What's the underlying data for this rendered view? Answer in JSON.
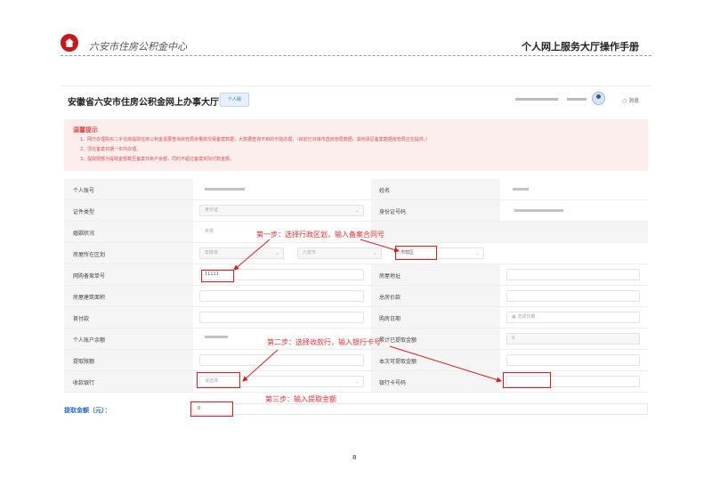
{
  "doc": {
    "org_name": "六安市住房公积金中心",
    "manual_title": "个人网上服务大厅操作手册",
    "page_number": "8"
  },
  "site": {
    "title": "安徽省六安市住房公积金网上办事大厅",
    "badge": "个人版",
    "message_link": "消息"
  },
  "tips": {
    "title": "温馨提示",
    "items": [
      "1、网厅办理购买二手住房提取住房公积金需要查询房管局存量房交易备案数据，大数据查询不到的不能办理；（目前已对接市直房管局数据，其他县区备案数据房管局正在提供。）",
      "2、须在备案日期一年内办理。",
      "3、提取限额为提取金额截至备案日账户余额，同时不超过备案实际付款金额。"
    ]
  },
  "form": {
    "account_label": "个人账号",
    "name_label": "姓名",
    "id_type_label": "证件类型",
    "id_type_value": "身份证",
    "id_number_label": "身份证号码",
    "marital_label": "婚姻状况",
    "marital_value": "未婚",
    "district_label": "房屋所在区划",
    "province_value": "安徽省",
    "city_value": "六安市",
    "district_value": "市辖区",
    "contract_label": "网购备案单号",
    "contract_value": "11111",
    "address_label": "房屋地址",
    "area_label": "房屋建筑面积",
    "total_price_label": "总房价款",
    "down_payment_label": "首付款",
    "purchase_date_label": "购房日期",
    "purchase_date_placeholder": "选择日期",
    "balance_label": "个人账户余额",
    "withdrawn_label": "累计已提取金额",
    "withdrawn_value": "0",
    "limit_label": "提取限额",
    "current_label": "本次可提取金额",
    "bank_label": "收款银行",
    "bank_placeholder": "请选择",
    "card_label": "银行卡号码",
    "amount_label": "提取金额（元）：",
    "amount_value": "0"
  },
  "annotations": {
    "step1": "第一步：选择行政区划，输入备案合同号",
    "step2": "第二步：选择收款行，输入银行卡号",
    "step3": "第三步：输入提取金额"
  },
  "colors": {
    "annotation_red": "#e01919",
    "tips_bg": "#fdeeee",
    "accent_blue": "#2b6cc4"
  }
}
